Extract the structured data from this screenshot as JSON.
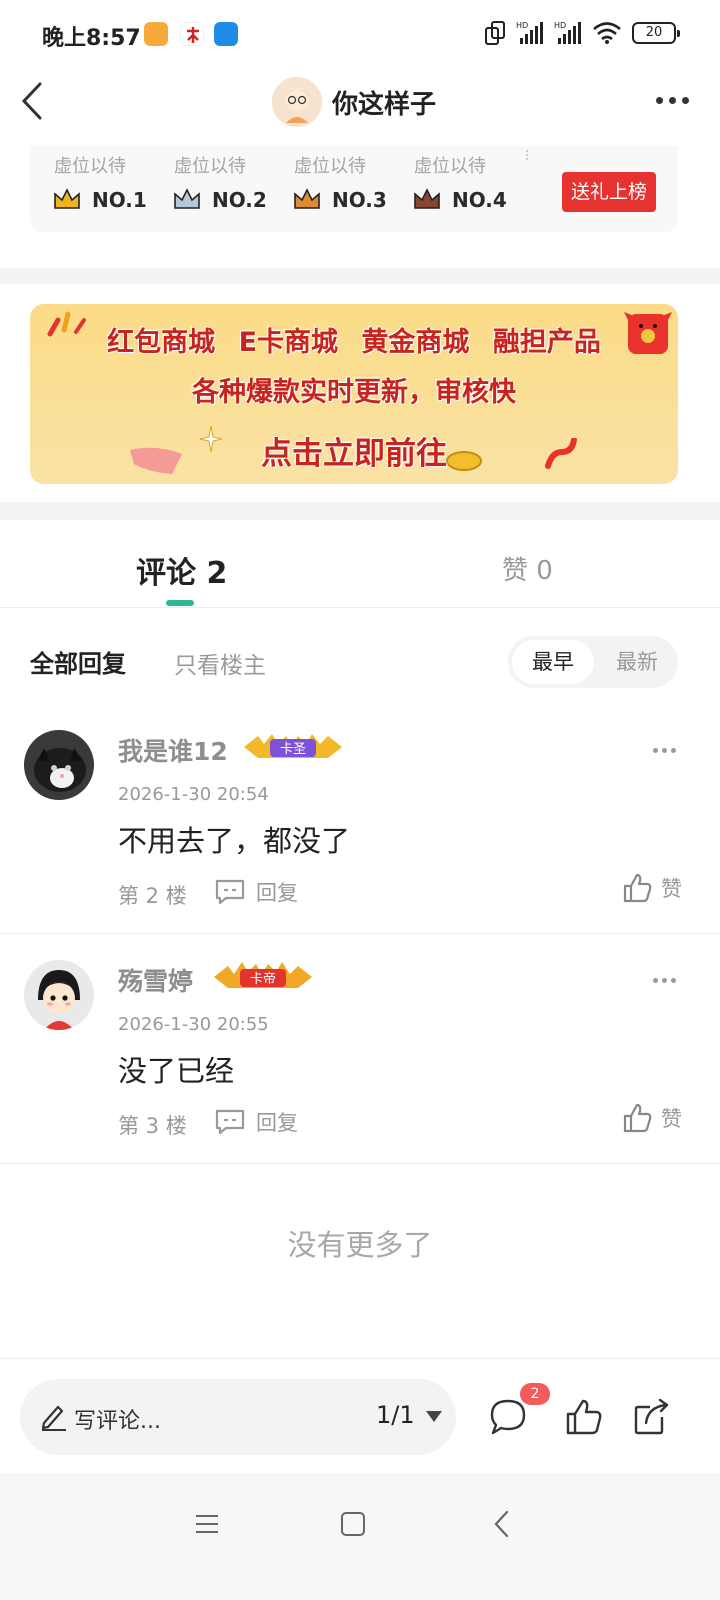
{
  "status_bar": {
    "time": "晚上8:57",
    "battery": "20",
    "icons": [
      "notification-app-icon",
      "notification-app-icon-2",
      "notification-app-icon-3",
      "screen-rotate-icon",
      "signal-hd-icon",
      "signal-hd-icon-2",
      "wifi-icon",
      "battery-icon"
    ]
  },
  "header": {
    "title": "你这样子",
    "back_icon": "chevron-left-icon",
    "more_icon": "more-dots-icon"
  },
  "rank": {
    "slots": [
      {
        "placeholder": "虚位以待",
        "rank": "NO.1",
        "crown_color": "#f2b21d"
      },
      {
        "placeholder": "虚位以待",
        "rank": "NO.2",
        "crown_color": "#9fb2c6"
      },
      {
        "placeholder": "虚位以待",
        "rank": "NO.3",
        "crown_color": "#e08a35"
      },
      {
        "placeholder": "虚位以待",
        "rank": "NO.4",
        "crown_color": "#7a3a2a"
      }
    ],
    "gift_button": "送礼上榜"
  },
  "banner": {
    "line1": "红包商城 E卡商城 黄金商城 融担产品",
    "line2": "各种爆款实时更新，审核快",
    "line3": "点击立即前往"
  },
  "tabs": {
    "comments": "评论 2",
    "likes": "赞 0"
  },
  "filter": {
    "all": "全部回复",
    "op_only": "只看楼主",
    "sort_earliest": "最早",
    "sort_latest": "最新"
  },
  "comments": [
    {
      "name": "我是谁12",
      "badge": "卡圣",
      "time": "2026-1-30 20:54",
      "text": "不用去了，都没了",
      "floor": "第 2 楼",
      "reply": "回复",
      "like": "赞"
    },
    {
      "name": "殇雪婷",
      "badge": "卡帝",
      "time": "2026-1-30 20:55",
      "text": "没了已经",
      "floor": "第 3 楼",
      "reply": "回复",
      "like": "赞"
    }
  ],
  "no_more": "没有更多了",
  "bottom_bar": {
    "placeholder": "写评论...",
    "page": "1/1",
    "comment_count": "2"
  },
  "colors": {
    "accent": "#2bb896",
    "gift_red": "#e7332f",
    "badge_red": "#f45b5b"
  }
}
